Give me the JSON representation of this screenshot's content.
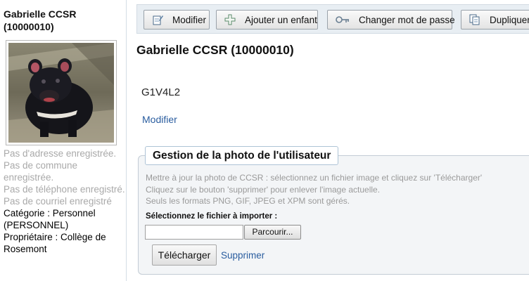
{
  "sidebar": {
    "title": "Gabrielle CCSR (10000010)",
    "photo_alt": "Tasmanian devil",
    "no_address": "Pas d'adresse enregistrée.",
    "no_commune": "Pas de commune enregistrée.",
    "no_phone": "Pas de téléphone enregistré.",
    "no_email": "Pas de courriel enregistré",
    "category": "Catégorie : Personnel (PERSONNEL)",
    "owner": "Propriétaire : Collège de Rosemont"
  },
  "toolbar": {
    "modify_label": "Modifier",
    "add_child_label": "Ajouter un enfant",
    "change_password_label": "Changer mot de passe",
    "duplicate_label": "Dupliquer"
  },
  "main": {
    "title": "Gabrielle CCSR (10000010)",
    "postal_code": "G1V4L2",
    "modify_link": "Modifier"
  },
  "photo_section": {
    "legend": "Gestion de la photo de l'utilisateur",
    "help_line1": "Mettre à jour la photo de CCSR : sélectionnez un fichier image et cliquez sur 'Télécharger'",
    "help_line2": "Cliquez sur le bouton 'supprimer' pour enlever l'image actuelle.",
    "help_line3": "Seuls les formats PNG, GIF, JPEG et XPM sont gérés.",
    "file_label": "Sélectionnez le fichier à importer :",
    "browse_label": "Parcourir...",
    "upload_label": "Télécharger",
    "delete_label": "Supprimer"
  }
}
